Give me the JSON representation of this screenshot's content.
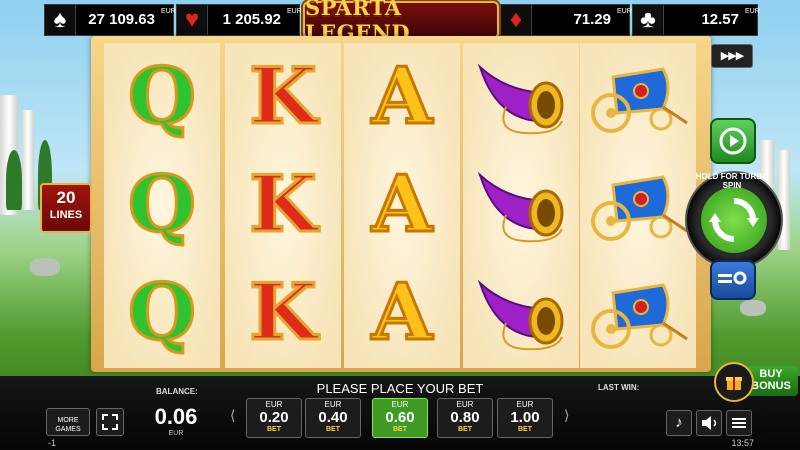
{
  "jackpots": [
    {
      "suit_icon": "spade-icon",
      "glyph": "♠",
      "color": "#ffffff",
      "value": "27 109.63",
      "currency": "EUR"
    },
    {
      "suit_icon": "heart-icon",
      "glyph": "♥",
      "color": "#e3231b",
      "value": "1 205.92",
      "currency": "EUR"
    },
    {
      "suit_icon": "diamond-icon",
      "glyph": "♦",
      "color": "#e3231b",
      "value": "71.29",
      "currency": "EUR"
    },
    {
      "suit_icon": "club-icon",
      "glyph": "♣",
      "color": "#ffffff",
      "value": "12.57",
      "currency": "EUR"
    }
  ],
  "logo": {
    "text": "SPARTA LEGEND"
  },
  "lines": {
    "count": "20",
    "label": "LINES"
  },
  "reels": [
    [
      "Q",
      "Q",
      "Q"
    ],
    [
      "K",
      "K",
      "K"
    ],
    [
      "A",
      "A",
      "A"
    ],
    [
      "horn",
      "horn",
      "horn"
    ],
    [
      "chariot",
      "chariot",
      "chariot"
    ]
  ],
  "controls": {
    "autoplay_glyph": "▶▶▶",
    "hold_turbo": "HOLD FOR TURBO SPIN",
    "buy_bonus_line1": "BUY",
    "buy_bonus_line2": "BONUS"
  },
  "bottom": {
    "more_games": "MORE GAMES",
    "balance_label": "BALANCE:",
    "balance_value": "0.06",
    "balance_currency": "EUR",
    "message": "PLEASE PLACE YOUR BET",
    "last_win_label": "LAST WIN:",
    "left_arrow": "⟨",
    "right_arrow": "⟩",
    "bets": [
      {
        "currency": "EUR",
        "value": "0.20",
        "label": "BET",
        "selected": false
      },
      {
        "currency": "EUR",
        "value": "0.40",
        "label": "BET",
        "selected": false
      },
      {
        "currency": "EUR",
        "value": "0.60",
        "label": "BET",
        "selected": true
      },
      {
        "currency": "EUR",
        "value": "0.80",
        "label": "BET",
        "selected": false
      },
      {
        "currency": "EUR",
        "value": "1.00",
        "label": "BET",
        "selected": false
      }
    ],
    "minus_indicator": "-1",
    "clock": "13:57"
  },
  "colors": {
    "accent_green": "#3d9a22",
    "gold": "#e8b640",
    "red": "#a0140e"
  }
}
